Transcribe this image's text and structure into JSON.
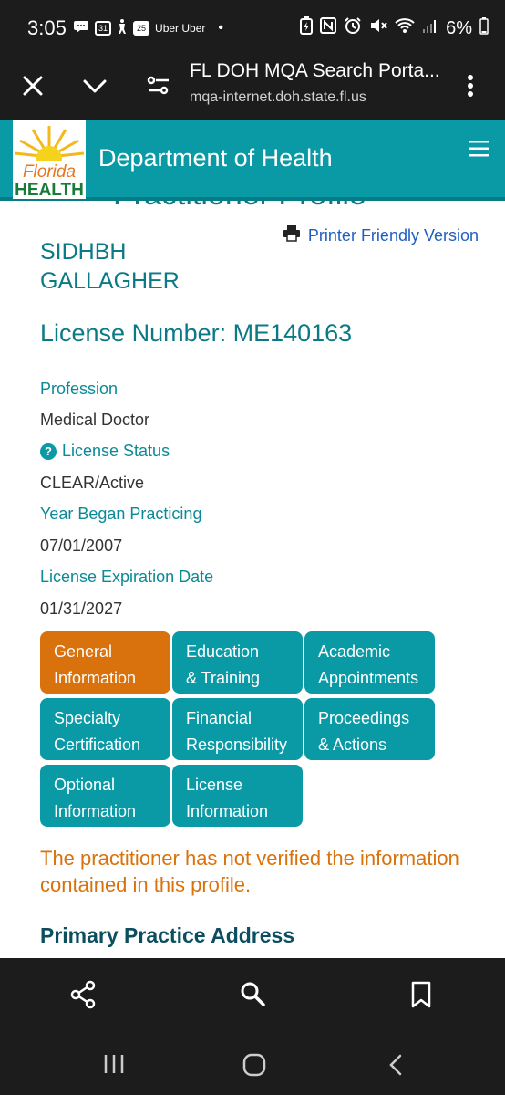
{
  "status_bar": {
    "time": "3:05",
    "calendar_day_1": "31",
    "calendar_day_2": "25",
    "uber_text": "Uber Uber",
    "battery": "6%"
  },
  "browser": {
    "title": "FL DOH MQA Search Porta...",
    "url": "mqa-internet.doh.state.fl.us"
  },
  "header": {
    "logo_line1": "Florida",
    "logo_line2": "HEALTH",
    "department": "Department of Health"
  },
  "profile": {
    "cutoff_heading": "Practitioner Profile",
    "printer_link": "Printer Friendly Version",
    "name_line1": "SIDHBH",
    "name_line2": "GALLAGHER",
    "license_number": "License Number: ME140163",
    "fields": {
      "profession_label": "Profession",
      "profession_value": "Medical Doctor",
      "status_label": "License Status",
      "status_value": "CLEAR/Active",
      "year_label": "Year Began Practicing",
      "year_value": "07/01/2007",
      "expiration_label": "License Expiration Date",
      "expiration_value": "01/31/2027"
    }
  },
  "tabs": [
    {
      "line1": "General",
      "line2": "Information"
    },
    {
      "line1": "Education",
      "line2": "& Training"
    },
    {
      "line1": "Academic",
      "line2": "Appointments"
    },
    {
      "line1": "Specialty",
      "line2": "Certification"
    },
    {
      "line1": "Financial",
      "line2": "Responsibility"
    },
    {
      "line1": "Proceedings",
      "line2": "& Actions"
    },
    {
      "line1": "Optional",
      "line2": "Information"
    },
    {
      "line1": "License",
      "line2": "Information"
    }
  ],
  "notice": "The practitioner has not verified the information contained in this profile.",
  "section_heading": "Primary Practice Address",
  "colors": {
    "teal": "#0a9aa6",
    "active_tab": "#d9720c",
    "heading_dark": "#0b4e60",
    "link_blue": "#1f5fbf"
  }
}
